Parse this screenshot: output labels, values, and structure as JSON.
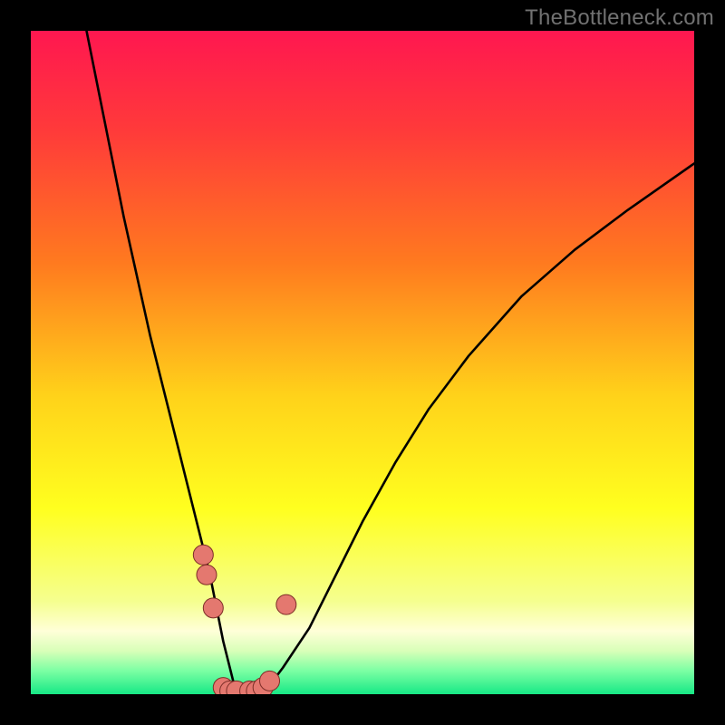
{
  "watermark": "TheBottleneck.com",
  "chart_data": {
    "type": "line",
    "title": "",
    "xlabel": "",
    "ylabel": "",
    "xlim": [
      0,
      100
    ],
    "ylim": [
      0,
      100
    ],
    "curve": {
      "x": [
        8,
        10,
        12,
        14,
        16,
        18,
        20,
        22,
        24,
        26,
        27,
        28,
        29,
        30,
        31,
        32,
        33,
        35,
        38,
        42,
        46,
        50,
        55,
        60,
        66,
        74,
        82,
        90,
        100
      ],
      "y": [
        102,
        92,
        82,
        72,
        63,
        54,
        46,
        38,
        30,
        22,
        18,
        13,
        8,
        4,
        0,
        0,
        0,
        0,
        4,
        10,
        18,
        26,
        35,
        43,
        51,
        60,
        67,
        73,
        80
      ]
    },
    "flat_zone_x": [
      29,
      36
    ],
    "markers": [
      {
        "x": 26.0,
        "y": 21.0
      },
      {
        "x": 26.5,
        "y": 18.0
      },
      {
        "x": 27.5,
        "y": 13.0
      },
      {
        "x": 29.0,
        "y": 1.0
      },
      {
        "x": 30.0,
        "y": 0.5
      },
      {
        "x": 31.0,
        "y": 0.5
      },
      {
        "x": 33.0,
        "y": 0.5
      },
      {
        "x": 34.0,
        "y": 0.5
      },
      {
        "x": 35.0,
        "y": 1.0
      },
      {
        "x": 36.0,
        "y": 2.0
      },
      {
        "x": 38.5,
        "y": 13.5
      }
    ],
    "gradient_stops": [
      {
        "offset": 0.0,
        "color": "#ff1750"
      },
      {
        "offset": 0.15,
        "color": "#ff3a3a"
      },
      {
        "offset": 0.35,
        "color": "#ff7a1f"
      },
      {
        "offset": 0.55,
        "color": "#ffd21a"
      },
      {
        "offset": 0.72,
        "color": "#ffff1f"
      },
      {
        "offset": 0.86,
        "color": "#f5ff8f"
      },
      {
        "offset": 0.905,
        "color": "#ffffd8"
      },
      {
        "offset": 0.935,
        "color": "#d8ffb8"
      },
      {
        "offset": 0.965,
        "color": "#7bffa3"
      },
      {
        "offset": 1.0,
        "color": "#17e886"
      }
    ],
    "marker_style": {
      "fill": "#e4786f",
      "stroke": "#7d2e28",
      "r": 11
    }
  }
}
